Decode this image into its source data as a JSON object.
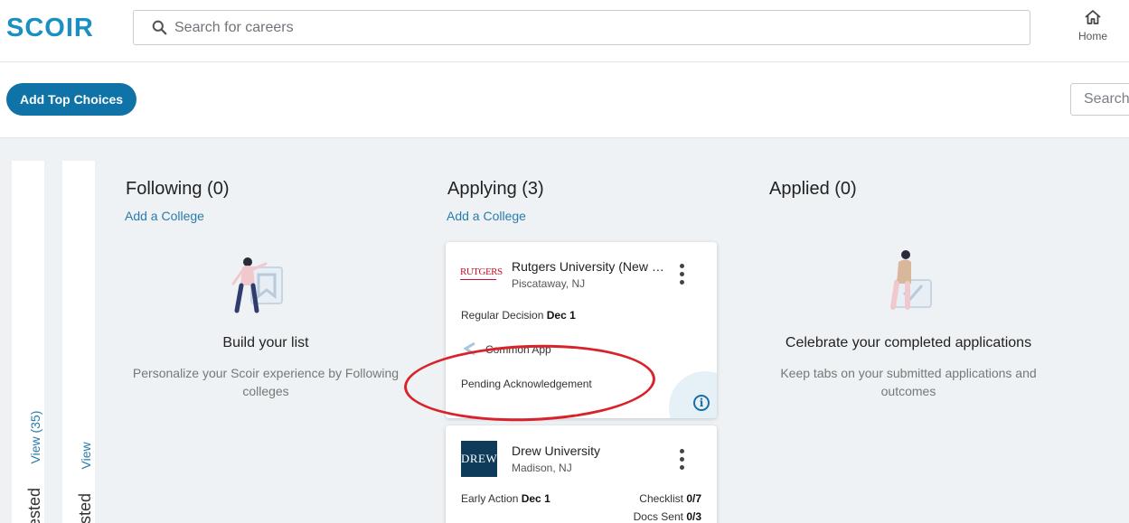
{
  "header": {
    "logo": "SCOIR",
    "search_placeholder": "Search for careers",
    "home_label": "Home"
  },
  "actions": {
    "add_top_choices": "Add Top Choices",
    "search_placeholder": "Search"
  },
  "side_tabs": [
    {
      "label": "erested",
      "link": "View (35)"
    },
    {
      "label": "gested",
      "link": "View"
    }
  ],
  "columns": {
    "following": {
      "title": "Following (0)",
      "add_link": "Add a College",
      "empty_title": "Build your list",
      "empty_desc": "Personalize your Scoir experience by Following colleges"
    },
    "applying": {
      "title": "Applying (3)",
      "add_link": "Add a College"
    },
    "applied": {
      "title": "Applied (0)",
      "empty_title": "Celebrate your completed applications",
      "empty_desc": "Keep tabs on your submitted applications and outcomes"
    }
  },
  "cards": [
    {
      "logo_text": "RUTGERS",
      "name": "Rutgers University (New Brunswick)",
      "location": "Piscataway, NJ",
      "decision_label": "Regular Decision",
      "decision_date": "Dec 1",
      "app_platform": "Common App",
      "status": "Pending Acknowledgement"
    },
    {
      "logo_text": "DREW",
      "name": "Drew University",
      "location": "Madison, NJ",
      "decision_label": "Early Action",
      "decision_date": "Dec 1",
      "checklist_label": "Checklist",
      "checklist_value": "0/7",
      "docs_label": "Docs Sent",
      "docs_value": "0/3"
    }
  ],
  "colors": {
    "brand": "#1a8fc4",
    "primary_button": "#0f73a8",
    "link": "#2b7bab",
    "annotation": "#d8232a"
  }
}
